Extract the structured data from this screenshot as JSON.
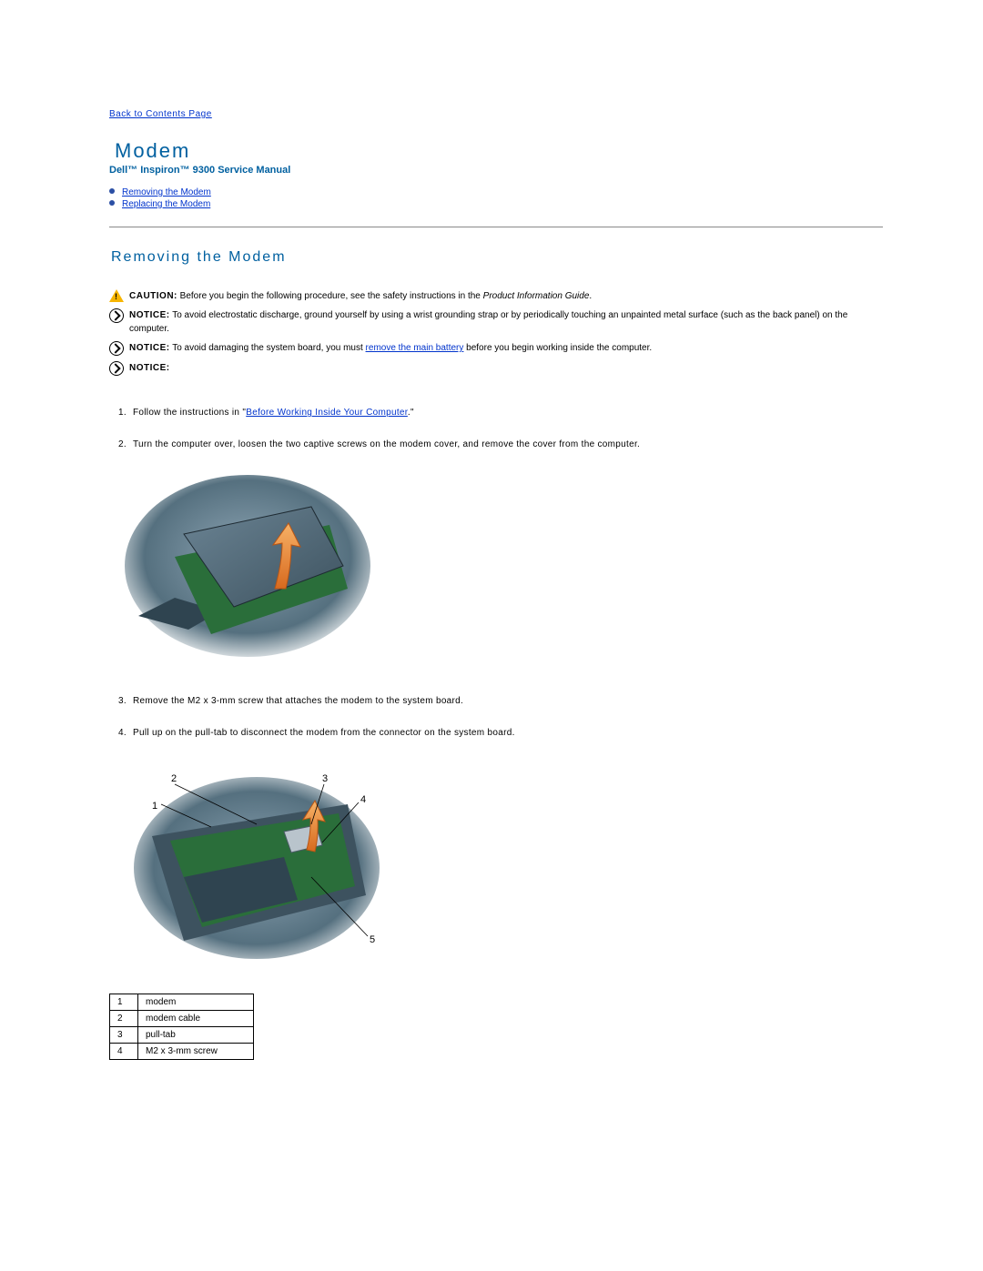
{
  "nav": {
    "back_link": "Back to Contents Page"
  },
  "header": {
    "title": "Modem",
    "subtitle": "Dell™ Inspiron™ 9300 Service Manual"
  },
  "toc": {
    "item1": "Removing the Modem",
    "item2": "Replacing the Modem"
  },
  "section": {
    "title": "Removing the Modem"
  },
  "notices": {
    "caution_label": "CAUTION:",
    "caution_text": "Before you begin the following procedure, see the safety instructions in the ",
    "caution_italic": "Product Information Guide",
    "caution_end": ".",
    "notice1_label": "NOTICE:",
    "notice1_text": " To avoid electrostatic discharge, ground yourself by using a wrist grounding strap or by periodically touching an unpainted metal surface (such as the back panel) on the computer.",
    "notice2_label": "NOTICE:",
    "notice2_text_a": " To avoid damaging the system board, you must ",
    "notice2_link": "remove the main battery",
    "notice2_text_b": " before you begin working inside the computer.",
    "notice3_label": "NOTICE:",
    "notice3_text": ""
  },
  "steps": {
    "s1_a": "Follow the instructions in \"",
    "s1_link": "Before Working Inside Your Computer",
    "s1_b": ".\"",
    "s2": "Turn the computer over, loosen the two captive screws on the modem cover, and remove the cover from the computer.",
    "s3": "Remove the M2 x 3-mm screw that attaches the modem to the system board.",
    "s4": "Pull up on the pull-tab to disconnect the modem from the connector on the system board."
  },
  "legend": {
    "r1n": "1",
    "r1t": "modem",
    "r2n": "2",
    "r2t": "modem cable",
    "r3n": "3",
    "r3t": "pull-tab",
    "r4n": "4",
    "r4t": "M2 x 3-mm screw"
  },
  "callouts": {
    "c1": "1",
    "c2": "2",
    "c3": "3",
    "c4": "4",
    "c5": "5"
  }
}
